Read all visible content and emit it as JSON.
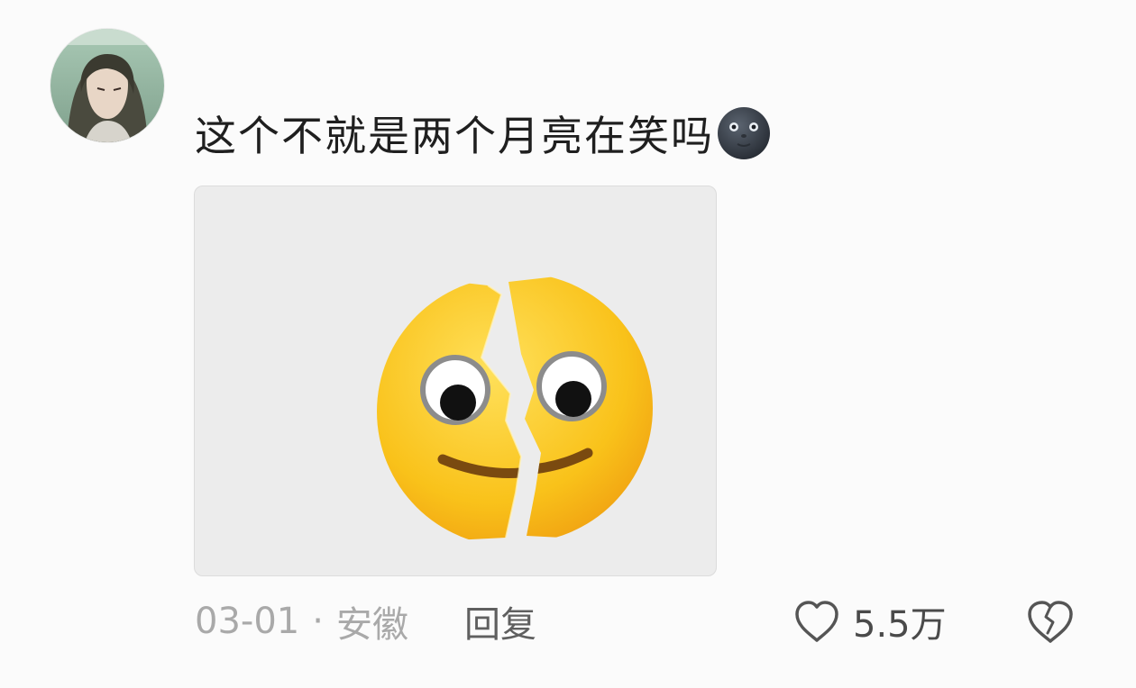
{
  "comment": {
    "text": "这个不就是两个月亮在笑吗",
    "trailing_emoji": "new-moon-face-emoji",
    "sticker": "broken-smiley-face-sticker",
    "date": "03-01",
    "separator": "·",
    "location": "安徽",
    "reply_label": "回复",
    "like_count": "5.5万"
  },
  "icons": {
    "like": "heart-outline-icon",
    "dislike": "broken-heart-outline-icon"
  },
  "colors": {
    "background": "#fbfbfb",
    "text_primary": "#1f1f1f",
    "text_meta": "#a9a9a9",
    "text_reply": "#5f5f5f",
    "sticker_bg": "#ececec",
    "emoji_yellow": "#f7c61c"
  }
}
